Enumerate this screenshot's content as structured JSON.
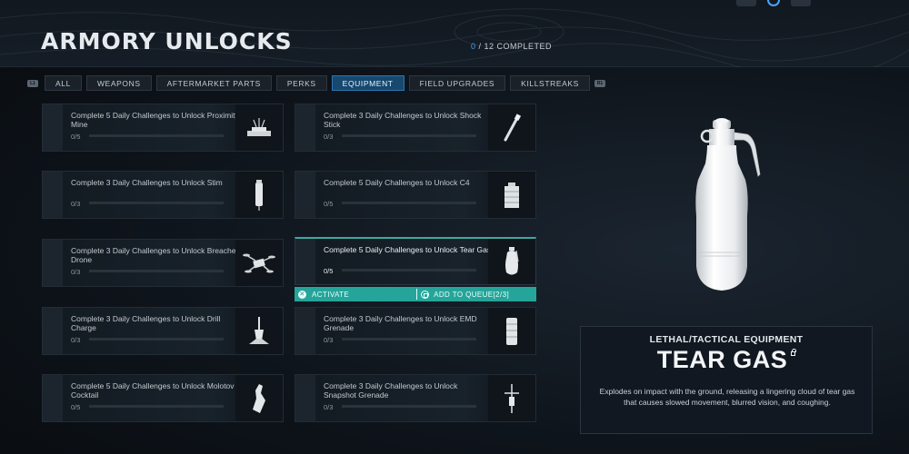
{
  "header": {
    "title": "ARMORY UNLOCKS",
    "completed_count": "0",
    "completed_suffix": "/ 12 COMPLETED"
  },
  "tabs": {
    "left_bumper": "L1",
    "right_bumper": "R1",
    "items": [
      {
        "label": "ALL",
        "active": false
      },
      {
        "label": "WEAPONS",
        "active": false
      },
      {
        "label": "AFTERMARKET PARTS",
        "active": false
      },
      {
        "label": "PERKS",
        "active": false
      },
      {
        "label": "EQUIPMENT",
        "active": true
      },
      {
        "label": "FIELD UPGRADES",
        "active": false
      },
      {
        "label": "KILLSTREAKS",
        "active": false
      }
    ]
  },
  "cards": [
    {
      "name": "Complete 5 Daily Challenges to Unlock Proximity Mine",
      "progress": "0/5",
      "icon": "proximity-mine-icon"
    },
    {
      "name": "Complete 3 Daily Challenges to Unlock Shock Stick",
      "progress": "0/3",
      "icon": "shock-stick-icon"
    },
    {
      "name": "Complete 3 Daily Challenges to Unlock Stim",
      "progress": "0/3",
      "icon": "stim-icon"
    },
    {
      "name": "Complete 5 Daily Challenges to Unlock C4",
      "progress": "0/5",
      "icon": "c4-icon"
    },
    {
      "name": "Complete 3 Daily Challenges to Unlock Breacher Drone",
      "progress": "0/3",
      "icon": "breacher-drone-icon"
    },
    {
      "name": "Complete 5 Daily Challenges to Unlock Tear Gas",
      "progress": "0/5",
      "icon": "tear-gas-icon",
      "selected": true
    },
    {
      "name": "Complete 3 Daily Challenges to Unlock Drill Charge",
      "progress": "0/3",
      "icon": "drill-charge-icon"
    },
    {
      "name": "Complete 3 Daily Challenges to Unlock EMD Grenade",
      "progress": "0/3",
      "icon": "emd-grenade-icon"
    },
    {
      "name": "Complete 5 Daily Challenges to Unlock Molotov Cocktail",
      "progress": "0/5",
      "icon": "molotov-icon"
    },
    {
      "name": "Complete 3 Daily Challenges to Unlock Snapshot Grenade",
      "progress": "0/3",
      "icon": "snapshot-grenade-icon"
    }
  ],
  "actions": {
    "activate_label": "ACTIVATE",
    "queue_label": "ADD TO QUEUE[2/3]"
  },
  "info": {
    "category": "LETHAL/TACTICAL EQUIPMENT",
    "item_name": "TEAR GAS",
    "description": "Explodes on impact with the ground, releasing a lingering cloud of tear gas that causes slowed movement, blurred vision, and coughing."
  },
  "colors": {
    "accent_blue": "#17486e",
    "selection_teal": "#25a59a"
  }
}
